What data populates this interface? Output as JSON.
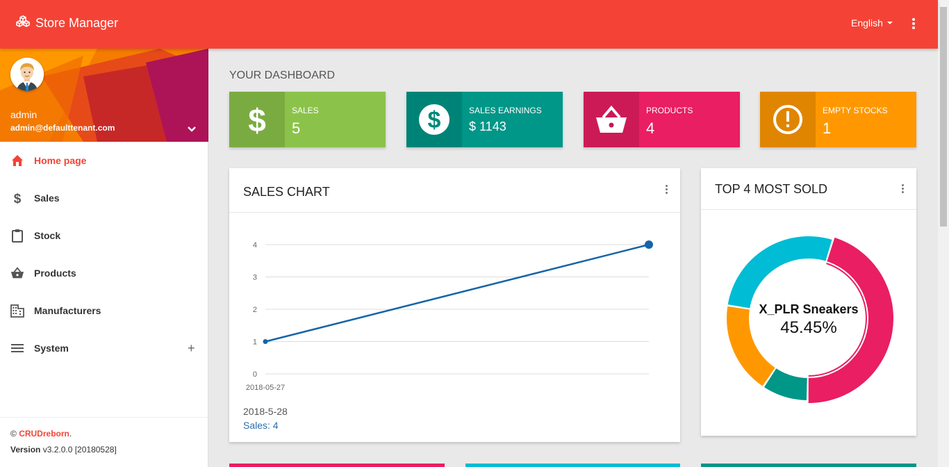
{
  "app": {
    "title": "Store Manager",
    "language": "English"
  },
  "user": {
    "name": "admin",
    "email": "admin@defaulttenant.com"
  },
  "menu": [
    {
      "label": "Home page",
      "icon": "home-icon",
      "active": true
    },
    {
      "label": "Sales",
      "icon": "dollar-icon"
    },
    {
      "label": "Stock",
      "icon": "clipboard-icon"
    },
    {
      "label": "Products",
      "icon": "basket-icon"
    },
    {
      "label": "Manufacturers",
      "icon": "building-icon"
    },
    {
      "label": "System",
      "icon": "menu-icon",
      "expand": "+"
    }
  ],
  "legal": {
    "copyright": "© ",
    "company": "CRUDreborn",
    "period": ".",
    "version_label": "Version",
    "version": " v3.2.0.0 [20180528]"
  },
  "dashboard": {
    "title": "YOUR DASHBOARD",
    "info_boxes": [
      {
        "label": "SALES",
        "value": "5",
        "color": "#8bc34a",
        "icon": "dollar-sign-icon"
      },
      {
        "label": "SALES EARNINGS",
        "value": "$ 1143",
        "color": "#009688",
        "icon": "dollar-circle-icon"
      },
      {
        "label": "PRODUCTS",
        "value": "4",
        "color": "#e91e63",
        "icon": "basket-icon"
      },
      {
        "label": "EMPTY STOCKS",
        "value": "1",
        "color": "#ff9800",
        "icon": "alert-circle-icon"
      }
    ],
    "sales_chart": {
      "title": "SALES CHART",
      "tooltip_date": "2018-5-28",
      "tooltip_value": "Sales: 4"
    },
    "top_sold": {
      "title": "TOP 4 MOST SOLD",
      "center_name": "X_PLR Sneakers",
      "center_value": "45.45%"
    }
  },
  "chart_data": [
    {
      "type": "line",
      "x": [
        "2018-05-27",
        "2018-05-28"
      ],
      "x_tick_labels": [
        "2018-05-27"
      ],
      "series": [
        {
          "values": [
            1,
            4
          ],
          "color": "#1565a8"
        }
      ],
      "ylim": [
        0,
        4
      ],
      "y_ticks": [
        0,
        1,
        2,
        3,
        4
      ],
      "grid": true
    },
    {
      "type": "pie",
      "labels": [
        "X_PLR Sneakers"
      ],
      "slices": [
        {
          "value": 45.45,
          "color": "#e91e63"
        },
        {
          "value": 9.09,
          "color": "#009688"
        },
        {
          "value": 18.18,
          "color": "#ff9800"
        },
        {
          "value": 27.27,
          "color": "#00bcd4"
        }
      ]
    }
  ]
}
